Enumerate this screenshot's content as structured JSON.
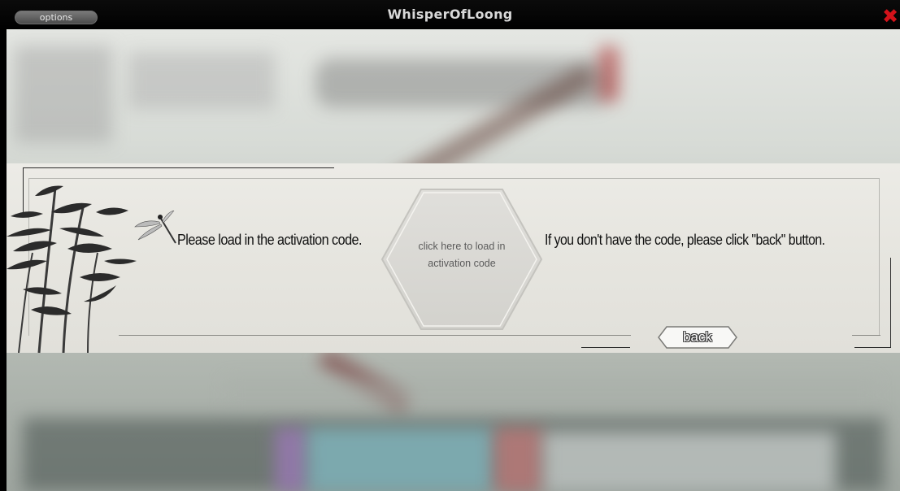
{
  "window": {
    "title": "WhisperOfLoong",
    "options_label": "options",
    "close_glyph": "✖"
  },
  "activation": {
    "message_left": "Please load in the activation code.",
    "load_button_label": "click here to load in activation code",
    "message_right": "If you don't have the code, please click \"back\" button.",
    "back_label": "back"
  },
  "colors": {
    "close": "#d3121a",
    "titlebar": "#000000",
    "panel": "#e8e7e1"
  },
  "icons": [
    "bamboo-icon",
    "dragonfly-icon",
    "close-icon"
  ]
}
